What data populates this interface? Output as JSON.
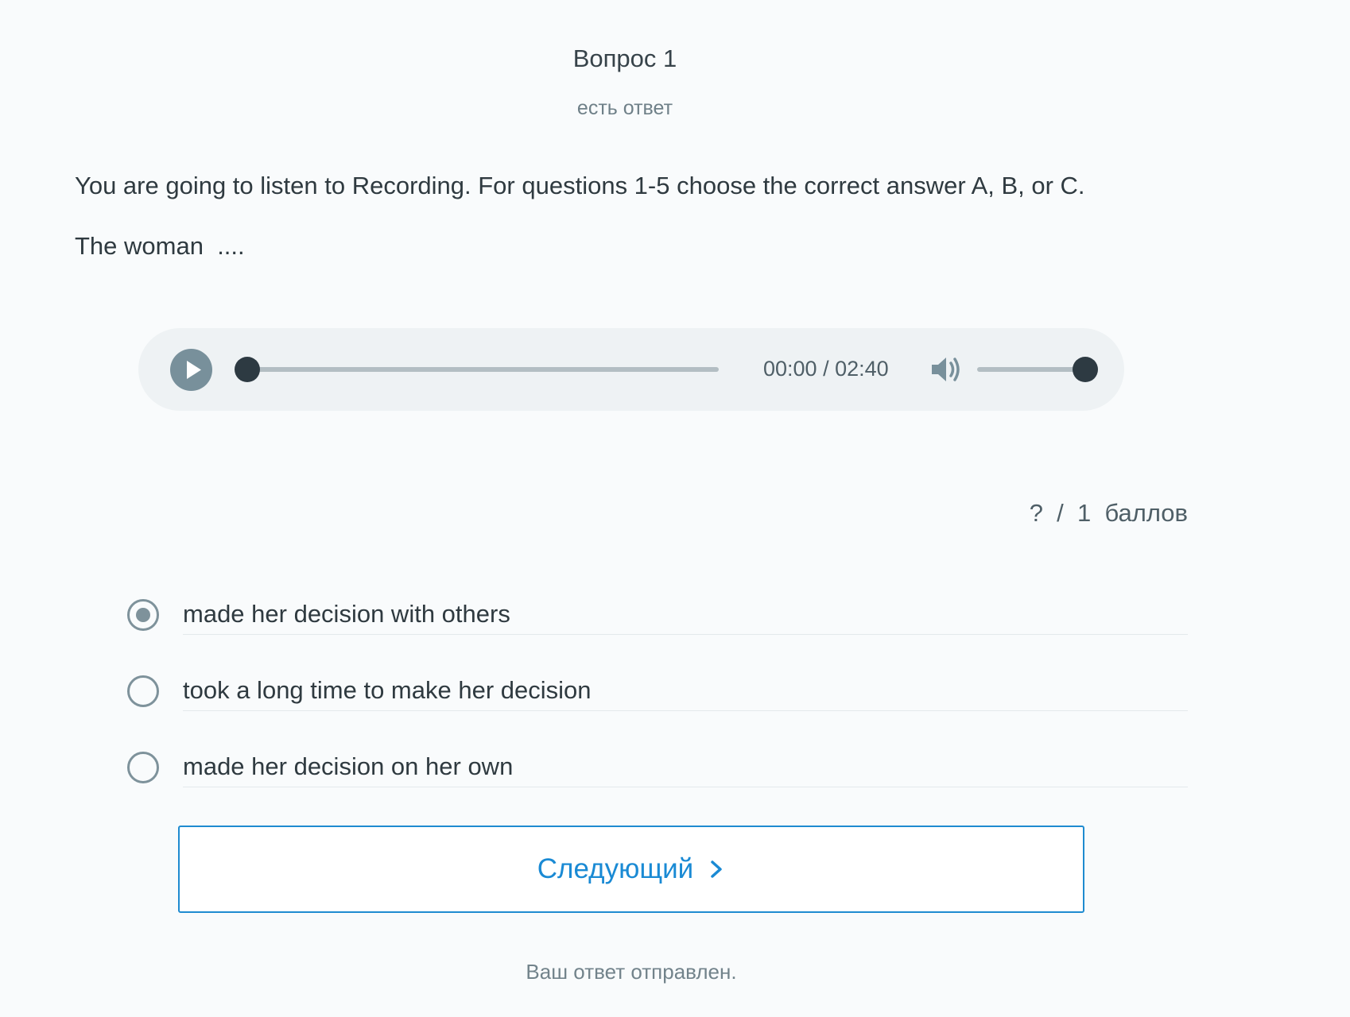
{
  "question": {
    "title": "Вопрос 1",
    "status": "есть ответ",
    "instructions": "You are going to listen to Recording. For questions 1-5 choose the correct answer A, B, or C.",
    "prompt": "The woman  ...."
  },
  "audio_player": {
    "play_icon": "play-icon",
    "time": "00:00 / 02:40",
    "progress_fraction": 0,
    "volume_icon": "speaker-icon",
    "volume_fraction": 1.0
  },
  "score": "?  /  1  баллов",
  "options": [
    {
      "label": "made her decision with others",
      "selected": true
    },
    {
      "label": "took a long time to make her decision",
      "selected": false
    },
    {
      "label": "made her decision on her own",
      "selected": false
    }
  ],
  "next_button": {
    "label": "Следующий",
    "icon": "chevron-right-icon"
  },
  "footer_message": "Ваш ответ отправлен.",
  "colors": {
    "accent": "#1a8ad4",
    "player_bg": "#eef2f4",
    "play_button": "#78909b",
    "slider_thumb": "#2d3a42",
    "radio": "#7e929b"
  }
}
